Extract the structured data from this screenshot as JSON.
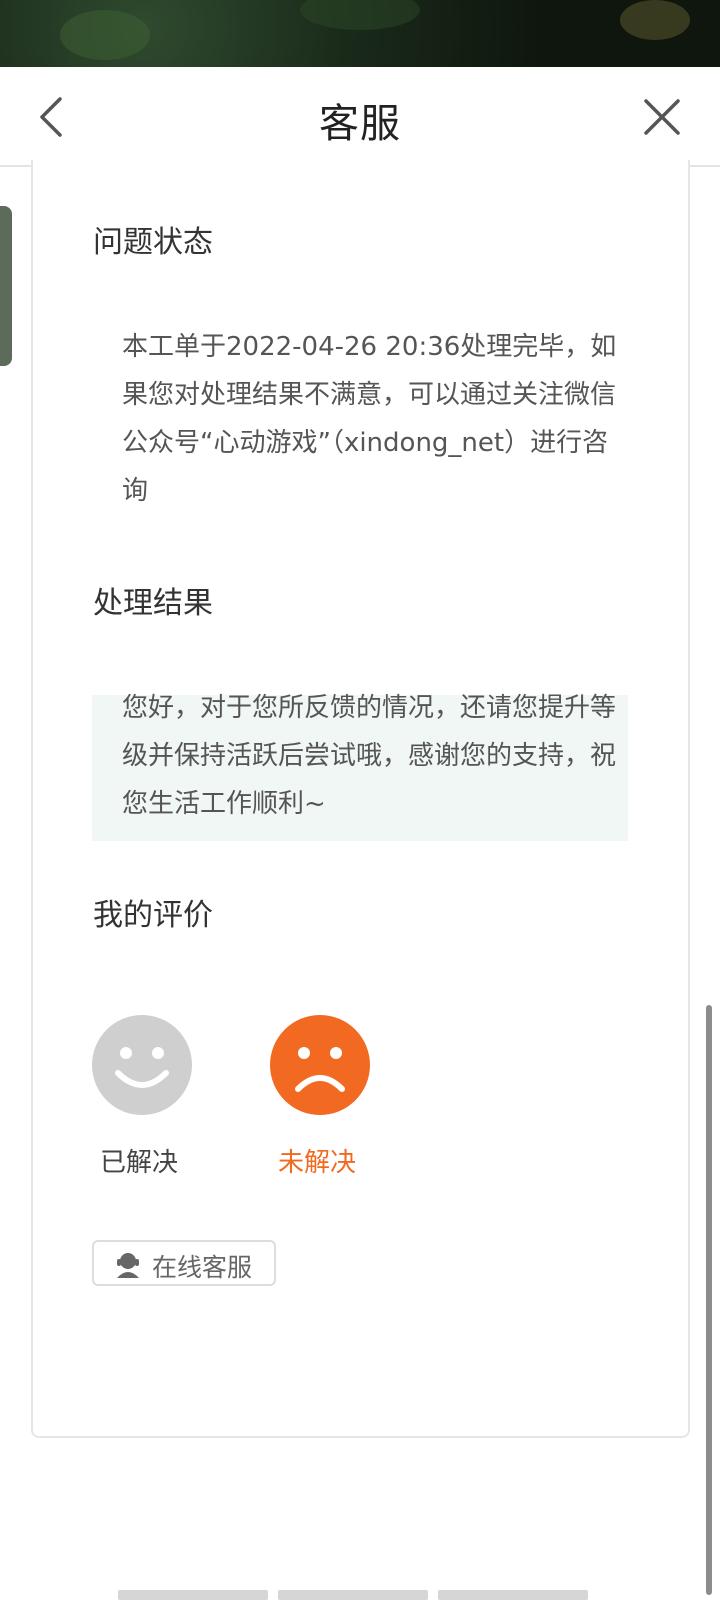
{
  "header": {
    "title": "客服"
  },
  "sections": {
    "status_title": "问题状态",
    "status_text": "本工单于2022-04-26 20:36处理完毕，如果您对处理结果不满意，可以通过关注微信公众号“心动游戏”（xindong_net）进行咨询",
    "result_title": "处理结果",
    "result_text": "您好，对于您所反馈的情况，还请您提升等级并保持活跃后尝试哦，感谢您的支持，祝您生活工作顺利~",
    "rating_title": "我的评价"
  },
  "rating": {
    "resolved_label": "已解决",
    "unresolved_label": "未解决",
    "selected": "unresolved"
  },
  "online_service": {
    "label": "在线客服"
  },
  "colors": {
    "accent": "#f26a21",
    "inactive_face": "#cfcfcf",
    "result_bg": "#f1f7f5"
  }
}
